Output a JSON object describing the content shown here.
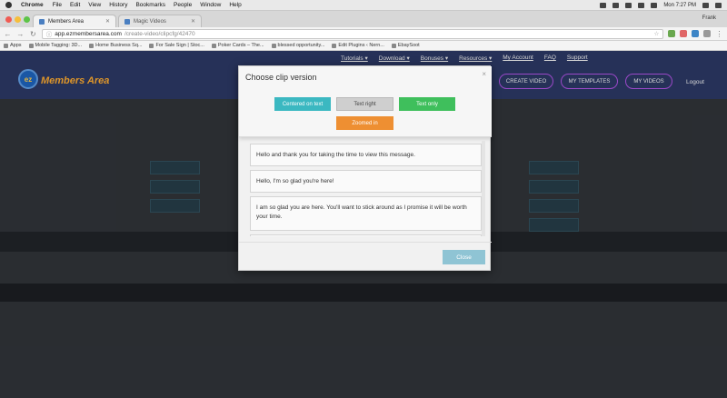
{
  "os_menubar": {
    "app_name": "Chrome",
    "items": [
      "File",
      "Edit",
      "View",
      "History",
      "Bookmarks",
      "People",
      "Window",
      "Help"
    ],
    "clock": "Mon 7:27 PM"
  },
  "browser": {
    "tabs": [
      {
        "label": "Members Area",
        "active": true
      },
      {
        "label": "Magic Videos",
        "active": false
      }
    ],
    "profile": "Frank",
    "url_domain": "app.ezmembersarea.com",
    "url_path": "/create-video/clipcfg/42470",
    "bookmarks": [
      "Apps",
      "Mobile Tagging: 3D...",
      "Home Business Sq...",
      "For Sale Sign | Stoc...",
      "Poker Cards – The...",
      "blessed opportunity...",
      "Edit Plugins ‹ Nern...",
      "EbaySoot"
    ]
  },
  "site": {
    "logo_badge": "ez",
    "logo_text": "Members Area",
    "top_nav": [
      "Tutorials ▾",
      "Download ▾",
      "Bonuses ▾",
      "Resources ▾",
      "My Account",
      "FAQ",
      "Support"
    ],
    "header_buttons": [
      "CREATE VIDEO",
      "MY TEMPLATES",
      "MY VIDEOS"
    ],
    "logout": "Logout"
  },
  "modal": {
    "title": "Choose clip version",
    "close_icon": "×",
    "options": [
      {
        "label": "Centered on text",
        "color": "#3bb8c1"
      },
      {
        "label": "Text right",
        "color": "#cfcfcf"
      },
      {
        "label": "Text only",
        "color": "#3fbf5c"
      },
      {
        "label": "Zoomed in",
        "color": "#ee8f32"
      }
    ],
    "messages": [
      "Hello and thank you for taking the time to view this message.",
      "Hello, I'm so glad you're here!",
      "I am so glad you are here. You'll want to stick around as I promise it will be worth your time."
    ],
    "close_button": "Close"
  }
}
